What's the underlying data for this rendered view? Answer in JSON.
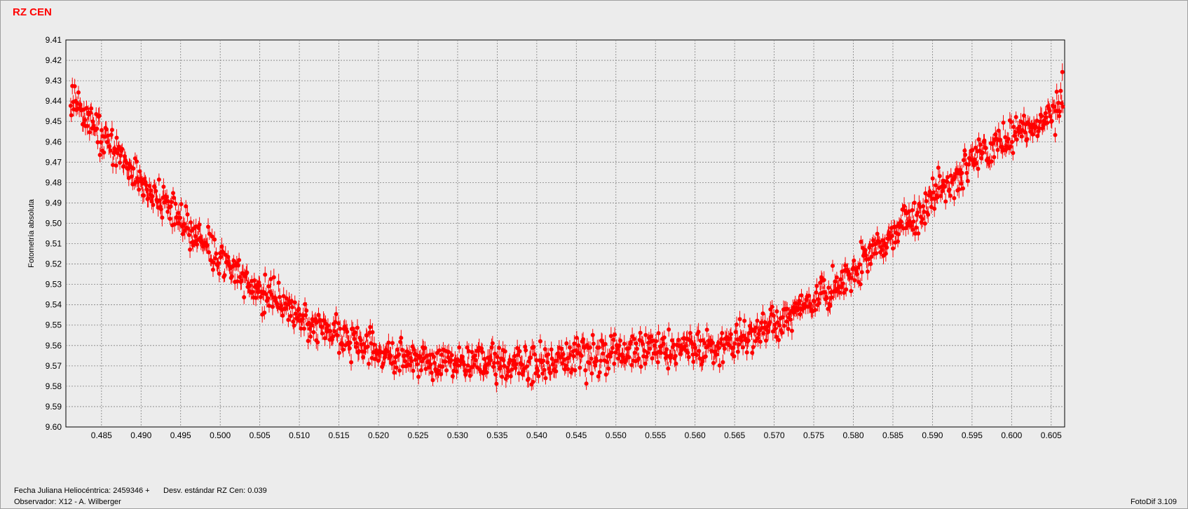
{
  "title": "RZ CEN",
  "footer": {
    "hjd": "Fecha Juliana Heliocéntrica: 2459346 +",
    "std": "Desv. estándar RZ Cen: 0.039",
    "observer": "Observador: X12 - A. Wilberger",
    "software": "FotoDif 3.109"
  },
  "colors": {
    "points": "#ff0000",
    "grid": "#808080",
    "background": "#ececec"
  },
  "chart_data": {
    "type": "scatter",
    "title": "RZ CEN",
    "xlabel": "",
    "ylabel": "Fotometría absoluta",
    "xlim": [
      0.4805,
      0.6067
    ],
    "ylim": [
      9.41,
      9.6
    ],
    "y_inverted": true,
    "grid": true,
    "error_bars": true,
    "xticks": [
      "0.485",
      "0.490",
      "0.495",
      "0.500",
      "0.505",
      "0.510",
      "0.515",
      "0.520",
      "0.525",
      "0.530",
      "0.535",
      "0.540",
      "0.545",
      "0.550",
      "0.555",
      "0.560",
      "0.565",
      "0.570",
      "0.575",
      "0.580",
      "0.585",
      "0.590",
      "0.595",
      "0.600",
      "0.605"
    ],
    "yticks": [
      "9.41",
      "9.42",
      "9.43",
      "9.44",
      "9.45",
      "9.46",
      "9.47",
      "9.48",
      "9.49",
      "9.50",
      "9.51",
      "9.52",
      "9.53",
      "9.54",
      "9.55",
      "9.56",
      "9.57",
      "9.58",
      "9.59",
      "9.60"
    ],
    "series": [
      {
        "x": [
          0.481,
          0.4825,
          0.484,
          0.4855,
          0.487,
          0.4885,
          0.49,
          0.4915,
          0.493,
          0.4945,
          0.496,
          0.4975,
          0.499,
          0.5005,
          0.502,
          0.5035,
          0.505,
          0.5065,
          0.508,
          0.5095,
          0.511,
          0.5125,
          0.514,
          0.5155,
          0.517,
          0.5185,
          0.52,
          0.5215,
          0.523,
          0.5245,
          0.526,
          0.5275,
          0.529,
          0.5305,
          0.532,
          0.5335,
          0.535,
          0.5365,
          0.538,
          0.5395,
          0.541,
          0.5425,
          0.544,
          0.5455,
          0.547,
          0.5485,
          0.55,
          0.5515,
          0.553,
          0.5545,
          0.556,
          0.5575,
          0.559,
          0.5605,
          0.562,
          0.5635,
          0.565,
          0.5665,
          0.568,
          0.5695,
          0.571,
          0.5725,
          0.574,
          0.5755,
          0.577,
          0.5785,
          0.58,
          0.5815,
          0.583,
          0.5845,
          0.586,
          0.5875,
          0.589,
          0.5905,
          0.592,
          0.5935,
          0.595,
          0.5965,
          0.598,
          0.5995,
          0.601,
          0.6025,
          0.604,
          0.6055,
          0.6065
        ],
        "y": [
          9.437,
          9.445,
          9.452,
          9.458,
          9.466,
          9.473,
          9.48,
          9.485,
          9.491,
          9.497,
          9.503,
          9.508,
          9.514,
          9.519,
          9.524,
          9.529,
          9.533,
          9.537,
          9.541,
          9.545,
          9.548,
          9.551,
          9.554,
          9.556,
          9.558,
          9.56,
          9.562,
          9.563,
          9.565,
          9.566,
          9.567,
          9.567,
          9.568,
          9.568,
          9.569,
          9.569,
          9.569,
          9.569,
          9.569,
          9.568,
          9.568,
          9.567,
          9.567,
          9.566,
          9.565,
          9.565,
          9.564,
          9.563,
          9.563,
          9.562,
          9.561,
          9.561,
          9.561,
          9.561,
          9.561,
          9.56,
          9.559,
          9.557,
          9.554,
          9.551,
          9.548,
          9.545,
          9.541,
          9.537,
          9.533,
          9.528,
          9.523,
          9.518,
          9.513,
          9.508,
          9.502,
          9.497,
          9.493,
          9.487,
          9.483,
          9.477,
          9.47,
          9.466,
          9.462,
          9.458,
          9.455,
          9.452,
          9.449,
          9.443,
          9.437
        ]
      }
    ]
  }
}
